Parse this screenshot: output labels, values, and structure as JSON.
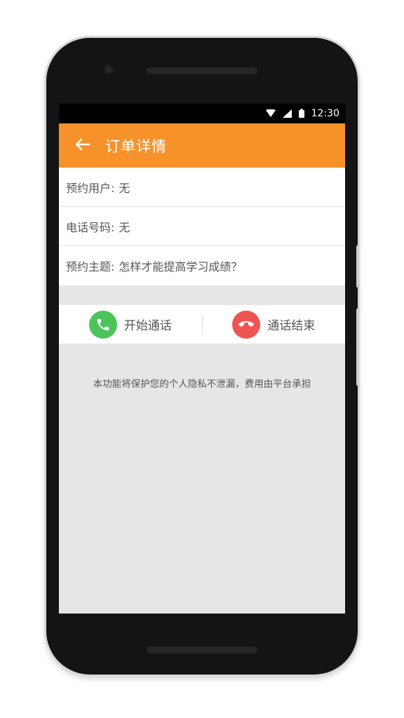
{
  "status_bar": {
    "time": "12:30",
    "icons": [
      "wifi-icon",
      "signal-icon",
      "battery-icon"
    ]
  },
  "toolbar": {
    "back_icon": "arrow-left-icon",
    "title": "订单详情",
    "background_color": "#f7922b"
  },
  "order": {
    "rows": [
      {
        "label": "预约用户:",
        "value": "无"
      },
      {
        "label": "电话号码:",
        "value": "无"
      },
      {
        "label": "预约主题:",
        "value": "怎样才能提高学习成绩？"
      }
    ]
  },
  "call_actions": {
    "start_label": "开始通话",
    "start_icon": "phone-icon",
    "start_color": "#4cc45c",
    "end_label": "通话结束",
    "end_icon": "hangup-icon",
    "end_color": "#ee5454"
  },
  "notice": "本功能将保护您的个人隐私不泄漏，费用由平台承担"
}
